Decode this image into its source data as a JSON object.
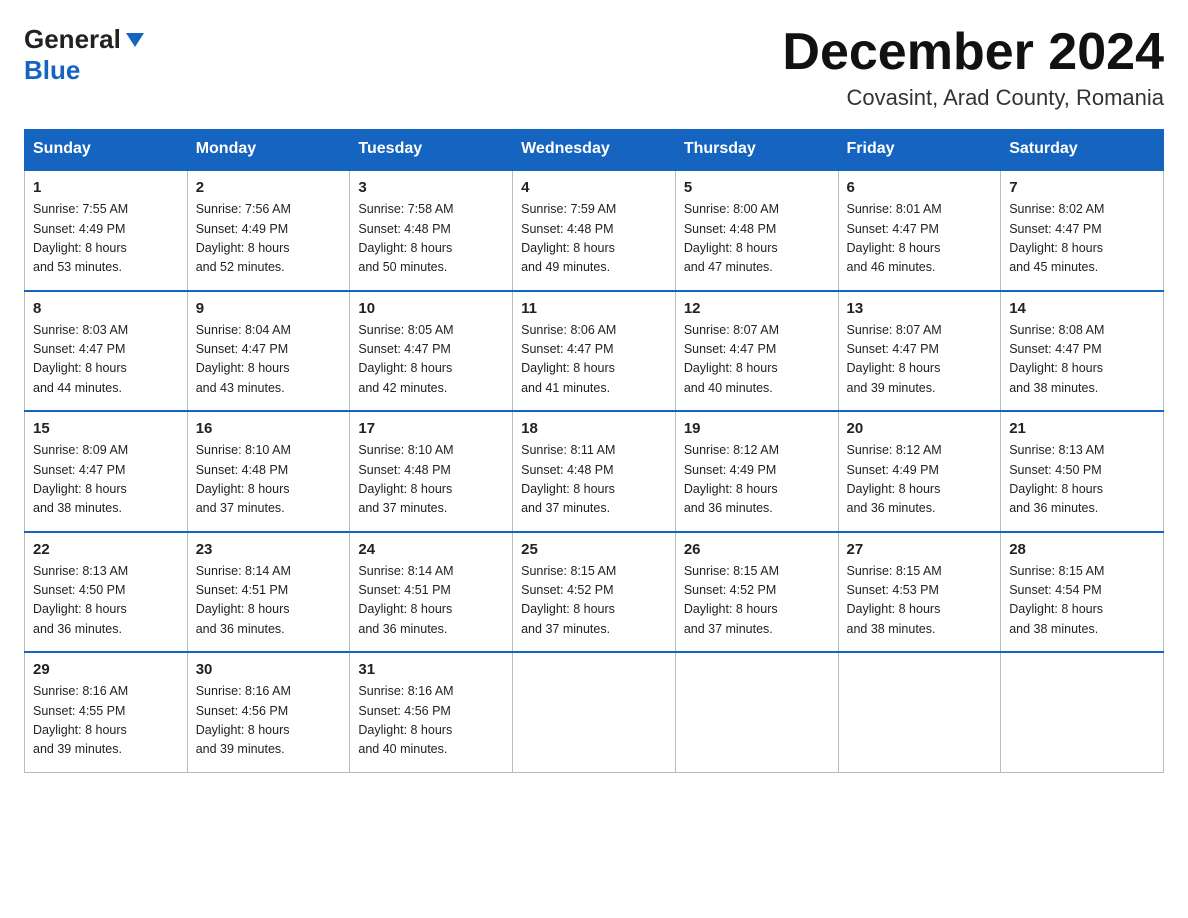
{
  "header": {
    "logo_general": "General",
    "logo_blue": "Blue",
    "month_title": "December 2024",
    "location": "Covasint, Arad County, Romania"
  },
  "columns": [
    "Sunday",
    "Monday",
    "Tuesday",
    "Wednesday",
    "Thursday",
    "Friday",
    "Saturday"
  ],
  "weeks": [
    [
      {
        "day": "1",
        "sunrise": "7:55 AM",
        "sunset": "4:49 PM",
        "daylight": "8 hours and 53 minutes."
      },
      {
        "day": "2",
        "sunrise": "7:56 AM",
        "sunset": "4:49 PM",
        "daylight": "8 hours and 52 minutes."
      },
      {
        "day": "3",
        "sunrise": "7:58 AM",
        "sunset": "4:48 PM",
        "daylight": "8 hours and 50 minutes."
      },
      {
        "day": "4",
        "sunrise": "7:59 AM",
        "sunset": "4:48 PM",
        "daylight": "8 hours and 49 minutes."
      },
      {
        "day": "5",
        "sunrise": "8:00 AM",
        "sunset": "4:48 PM",
        "daylight": "8 hours and 47 minutes."
      },
      {
        "day": "6",
        "sunrise": "8:01 AM",
        "sunset": "4:47 PM",
        "daylight": "8 hours and 46 minutes."
      },
      {
        "day": "7",
        "sunrise": "8:02 AM",
        "sunset": "4:47 PM",
        "daylight": "8 hours and 45 minutes."
      }
    ],
    [
      {
        "day": "8",
        "sunrise": "8:03 AM",
        "sunset": "4:47 PM",
        "daylight": "8 hours and 44 minutes."
      },
      {
        "day": "9",
        "sunrise": "8:04 AM",
        "sunset": "4:47 PM",
        "daylight": "8 hours and 43 minutes."
      },
      {
        "day": "10",
        "sunrise": "8:05 AM",
        "sunset": "4:47 PM",
        "daylight": "8 hours and 42 minutes."
      },
      {
        "day": "11",
        "sunrise": "8:06 AM",
        "sunset": "4:47 PM",
        "daylight": "8 hours and 41 minutes."
      },
      {
        "day": "12",
        "sunrise": "8:07 AM",
        "sunset": "4:47 PM",
        "daylight": "8 hours and 40 minutes."
      },
      {
        "day": "13",
        "sunrise": "8:07 AM",
        "sunset": "4:47 PM",
        "daylight": "8 hours and 39 minutes."
      },
      {
        "day": "14",
        "sunrise": "8:08 AM",
        "sunset": "4:47 PM",
        "daylight": "8 hours and 38 minutes."
      }
    ],
    [
      {
        "day": "15",
        "sunrise": "8:09 AM",
        "sunset": "4:47 PM",
        "daylight": "8 hours and 38 minutes."
      },
      {
        "day": "16",
        "sunrise": "8:10 AM",
        "sunset": "4:48 PM",
        "daylight": "8 hours and 37 minutes."
      },
      {
        "day": "17",
        "sunrise": "8:10 AM",
        "sunset": "4:48 PM",
        "daylight": "8 hours and 37 minutes."
      },
      {
        "day": "18",
        "sunrise": "8:11 AM",
        "sunset": "4:48 PM",
        "daylight": "8 hours and 37 minutes."
      },
      {
        "day": "19",
        "sunrise": "8:12 AM",
        "sunset": "4:49 PM",
        "daylight": "8 hours and 36 minutes."
      },
      {
        "day": "20",
        "sunrise": "8:12 AM",
        "sunset": "4:49 PM",
        "daylight": "8 hours and 36 minutes."
      },
      {
        "day": "21",
        "sunrise": "8:13 AM",
        "sunset": "4:50 PM",
        "daylight": "8 hours and 36 minutes."
      }
    ],
    [
      {
        "day": "22",
        "sunrise": "8:13 AM",
        "sunset": "4:50 PM",
        "daylight": "8 hours and 36 minutes."
      },
      {
        "day": "23",
        "sunrise": "8:14 AM",
        "sunset": "4:51 PM",
        "daylight": "8 hours and 36 minutes."
      },
      {
        "day": "24",
        "sunrise": "8:14 AM",
        "sunset": "4:51 PM",
        "daylight": "8 hours and 36 minutes."
      },
      {
        "day": "25",
        "sunrise": "8:15 AM",
        "sunset": "4:52 PM",
        "daylight": "8 hours and 37 minutes."
      },
      {
        "day": "26",
        "sunrise": "8:15 AM",
        "sunset": "4:52 PM",
        "daylight": "8 hours and 37 minutes."
      },
      {
        "day": "27",
        "sunrise": "8:15 AM",
        "sunset": "4:53 PM",
        "daylight": "8 hours and 38 minutes."
      },
      {
        "day": "28",
        "sunrise": "8:15 AM",
        "sunset": "4:54 PM",
        "daylight": "8 hours and 38 minutes."
      }
    ],
    [
      {
        "day": "29",
        "sunrise": "8:16 AM",
        "sunset": "4:55 PM",
        "daylight": "8 hours and 39 minutes."
      },
      {
        "day": "30",
        "sunrise": "8:16 AM",
        "sunset": "4:56 PM",
        "daylight": "8 hours and 39 minutes."
      },
      {
        "day": "31",
        "sunrise": "8:16 AM",
        "sunset": "4:56 PM",
        "daylight": "8 hours and 40 minutes."
      },
      null,
      null,
      null,
      null
    ]
  ],
  "labels": {
    "sunrise": "Sunrise:",
    "sunset": "Sunset:",
    "daylight": "Daylight:"
  }
}
